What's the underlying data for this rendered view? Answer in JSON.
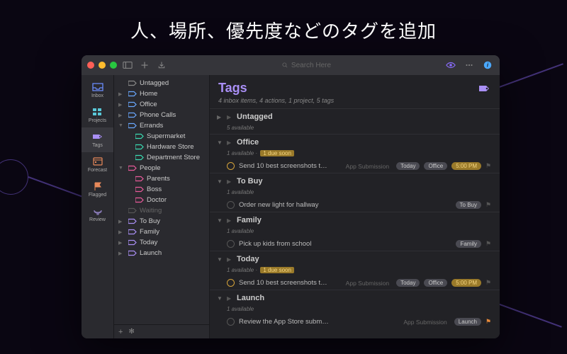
{
  "headline": "人、場所、優先度などのタグを追加",
  "toolbar": {
    "search_placeholder": "Search Here",
    "colors": {
      "red": "#ff5f57",
      "yellow": "#febc2e",
      "green": "#28c840",
      "eye": "#8a6dff",
      "info": "#4aa8ff"
    }
  },
  "rail": [
    {
      "label": "Inbox",
      "color": "#6a8dff",
      "active": false
    },
    {
      "label": "Projects",
      "color": "#5ac8d8",
      "active": false
    },
    {
      "label": "Tags",
      "color": "#a98ff5",
      "active": true
    },
    {
      "label": "Forecast",
      "color": "#e8895a",
      "active": false
    },
    {
      "label": "Flagged",
      "color": "#e8895a",
      "active": false
    },
    {
      "label": "Review",
      "color": "#8a7bb8",
      "active": false
    }
  ],
  "sidebar": {
    "items": [
      {
        "label": "Untagged",
        "level": 0,
        "color": "#888",
        "disc": ""
      },
      {
        "label": "Home",
        "level": 0,
        "color": "#6aa8ff",
        "disc": "▶"
      },
      {
        "label": "Office",
        "level": 0,
        "color": "#6aa8ff",
        "disc": "▶"
      },
      {
        "label": "Phone Calls",
        "level": 0,
        "color": "#6aa8ff",
        "disc": "▶"
      },
      {
        "label": "Errands",
        "level": 0,
        "color": "#6aa8ff",
        "disc": "▼"
      },
      {
        "label": "Supermarket",
        "level": 1,
        "color": "#3adbb2",
        "disc": ""
      },
      {
        "label": "Hardware Store",
        "level": 1,
        "color": "#3adbb2",
        "disc": ""
      },
      {
        "label": "Department Store",
        "level": 1,
        "color": "#3adbb2",
        "disc": ""
      },
      {
        "label": "People",
        "level": 0,
        "color": "#e85a9a",
        "disc": "▼"
      },
      {
        "label": "Parents",
        "level": 1,
        "color": "#e85a9a",
        "disc": ""
      },
      {
        "label": "Boss",
        "level": 1,
        "color": "#e85a9a",
        "disc": ""
      },
      {
        "label": "Doctor",
        "level": 1,
        "color": "#e85a9a",
        "disc": ""
      },
      {
        "label": "Waiting",
        "level": 0,
        "color": "#555",
        "disc": "",
        "muted": true
      },
      {
        "label": "To Buy",
        "level": 0,
        "color": "#a98ff5",
        "disc": "▶"
      },
      {
        "label": "Family",
        "level": 0,
        "color": "#a98ff5",
        "disc": "▶"
      },
      {
        "label": "Today",
        "level": 0,
        "color": "#a98ff5",
        "disc": "▶"
      },
      {
        "label": "Launch",
        "level": 0,
        "color": "#a98ff5",
        "disc": "▶"
      }
    ]
  },
  "main": {
    "title": "Tags",
    "subtitle": "4 inbox items, 4 actions, 1 project, 5 tags",
    "groups": [
      {
        "title": "Untagged",
        "expanded": false,
        "sub": "5 available",
        "due_soon": false,
        "tasks": []
      },
      {
        "title": "Office",
        "expanded": true,
        "sub": "1 available · ",
        "due_soon": true,
        "tasks": [
          {
            "title": "Send 10 best screenshots t…",
            "proj": "App Submission",
            "pills": [
              "Today",
              "Office"
            ],
            "time": "5:00 PM",
            "due": true,
            "flag": false
          }
        ]
      },
      {
        "title": "To Buy",
        "expanded": true,
        "sub": "1 available",
        "due_soon": false,
        "tasks": [
          {
            "title": "Order new light for hallway",
            "proj": "",
            "pills": [
              "To Buy"
            ],
            "time": "",
            "due": false,
            "flag": false
          }
        ]
      },
      {
        "title": "Family",
        "expanded": true,
        "sub": "1 available",
        "due_soon": false,
        "tasks": [
          {
            "title": "Pick up kids from school",
            "proj": "",
            "pills": [
              "Family"
            ],
            "time": "",
            "due": false,
            "flag": false
          }
        ]
      },
      {
        "title": "Today",
        "expanded": true,
        "sub": "1 available · ",
        "due_soon": true,
        "tasks": [
          {
            "title": "Send 10 best screenshots t…",
            "proj": "App Submission",
            "pills": [
              "Today",
              "Office"
            ],
            "time": "5:00 PM",
            "due": true,
            "flag": false
          }
        ]
      },
      {
        "title": "Launch",
        "expanded": true,
        "sub": "1 available",
        "due_soon": false,
        "tasks": [
          {
            "title": "Review the App Store subm…",
            "proj": "App Submission",
            "pills": [
              "Launch"
            ],
            "time": "",
            "due": false,
            "flag": true
          }
        ]
      }
    ],
    "due_soon_label": "1 due soon"
  }
}
